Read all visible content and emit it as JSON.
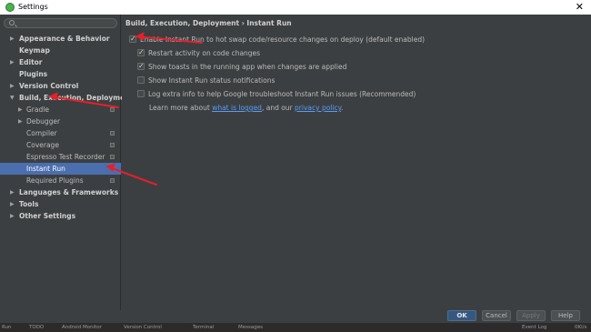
{
  "window": {
    "title": "Settings",
    "close_glyph": "✕"
  },
  "search": {
    "placeholder": ""
  },
  "sidebar": {
    "items": [
      {
        "label": "Appearance & Behavior",
        "arrow": "▶",
        "bold": true
      },
      {
        "label": "Keymap",
        "arrow": "",
        "bold": true
      },
      {
        "label": "Editor",
        "arrow": "▶",
        "bold": true
      },
      {
        "label": "Plugins",
        "arrow": "",
        "bold": true
      },
      {
        "label": "Version Control",
        "arrow": "▶",
        "bold": true
      },
      {
        "label": "Build, Execution, Deployment",
        "arrow": "▼",
        "bold": true
      },
      {
        "label": "Gradle",
        "arrow": "▶",
        "sub": true,
        "badge": true
      },
      {
        "label": "Debugger",
        "arrow": "▶",
        "sub": true
      },
      {
        "label": "Compiler",
        "arrow": "",
        "sub": true,
        "badge": true
      },
      {
        "label": "Coverage",
        "arrow": "",
        "sub": true,
        "badge": true
      },
      {
        "label": "Espresso Test Recorder",
        "arrow": "",
        "sub": true,
        "badge": true
      },
      {
        "label": "Instant Run",
        "arrow": "",
        "sub": true,
        "selected": true
      },
      {
        "label": "Required Plugins",
        "arrow": "",
        "sub": true,
        "badge": true
      },
      {
        "label": "Languages & Frameworks",
        "arrow": "▶",
        "bold": true
      },
      {
        "label": "Tools",
        "arrow": "▶",
        "bold": true
      },
      {
        "label": "Other Settings",
        "arrow": "▶",
        "bold": true
      }
    ]
  },
  "content": {
    "breadcrumb": "Build, Execution, Deployment › Instant Run",
    "options": [
      {
        "label": "Enable Instant Run to hot swap code/resource changes on deploy (default enabled)",
        "checked": true
      },
      {
        "label": "Restart activity on code changes",
        "checked": true
      },
      {
        "label": "Show toasts in the running app when changes are applied",
        "checked": true
      },
      {
        "label": "Show Instant Run status notifications",
        "checked": false
      },
      {
        "label": "Log extra info to help Google troubleshoot Instant Run issues (Recommended)",
        "checked": false
      }
    ],
    "learn": {
      "prefix": "Learn more about ",
      "link1": "what is logged",
      "middle": ", and our ",
      "link2": "privacy policy",
      "suffix": "."
    }
  },
  "footer": {
    "ok": "OK",
    "cancel": "Cancel",
    "apply": "Apply",
    "help": "Help"
  },
  "taskbar": {
    "items": [
      "Run",
      "TODO",
      "Android Monitor",
      "Version Control",
      "Terminal",
      "Messages",
      "Event Log"
    ],
    "clock": "0Kl/s"
  },
  "colors": {
    "accent": "#4b6eaf",
    "annotation": "#e5202a",
    "link": "#589df6"
  }
}
